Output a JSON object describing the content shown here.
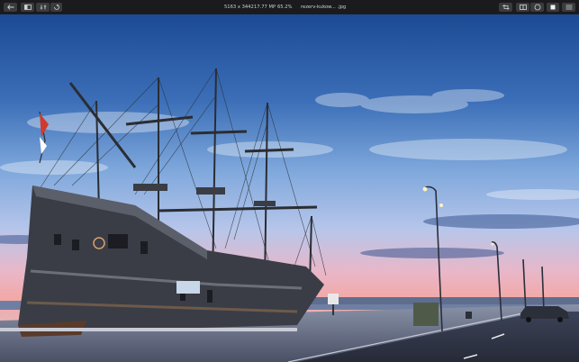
{
  "toolbar": {
    "left_buttons": [
      {
        "name": "back-button",
        "icon": "arrow-left-icon"
      },
      {
        "name": "sidebar-toggle-button",
        "icon": "sidebar-icon"
      },
      {
        "name": "adjust-button",
        "icon": "sliders-icon"
      },
      {
        "name": "rotate-button",
        "icon": "rotate-icon"
      }
    ],
    "dimensions": "5163 x 3442",
    "megapixels": "17.77 MP",
    "zoom": "65.2%",
    "filename": "rezerv-kukow... .jpg",
    "right_buttons": [
      {
        "name": "crop-button",
        "icon": "crop-icon"
      },
      {
        "name": "split-view-button",
        "icon": "split-icon"
      },
      {
        "name": "circle-tool-button",
        "icon": "circle-icon"
      },
      {
        "name": "highlight-button",
        "icon": "square-icon"
      },
      {
        "name": "more-button",
        "icon": "menu-icon"
      }
    ],
    "accent": "#3b3b3e"
  },
  "image": {
    "subject": "galleon-in-harbor-at-dusk",
    "sky_top": "#1f4f9a",
    "sky_mid": "#6f9fd6",
    "horizon": "#f3b9b8"
  }
}
